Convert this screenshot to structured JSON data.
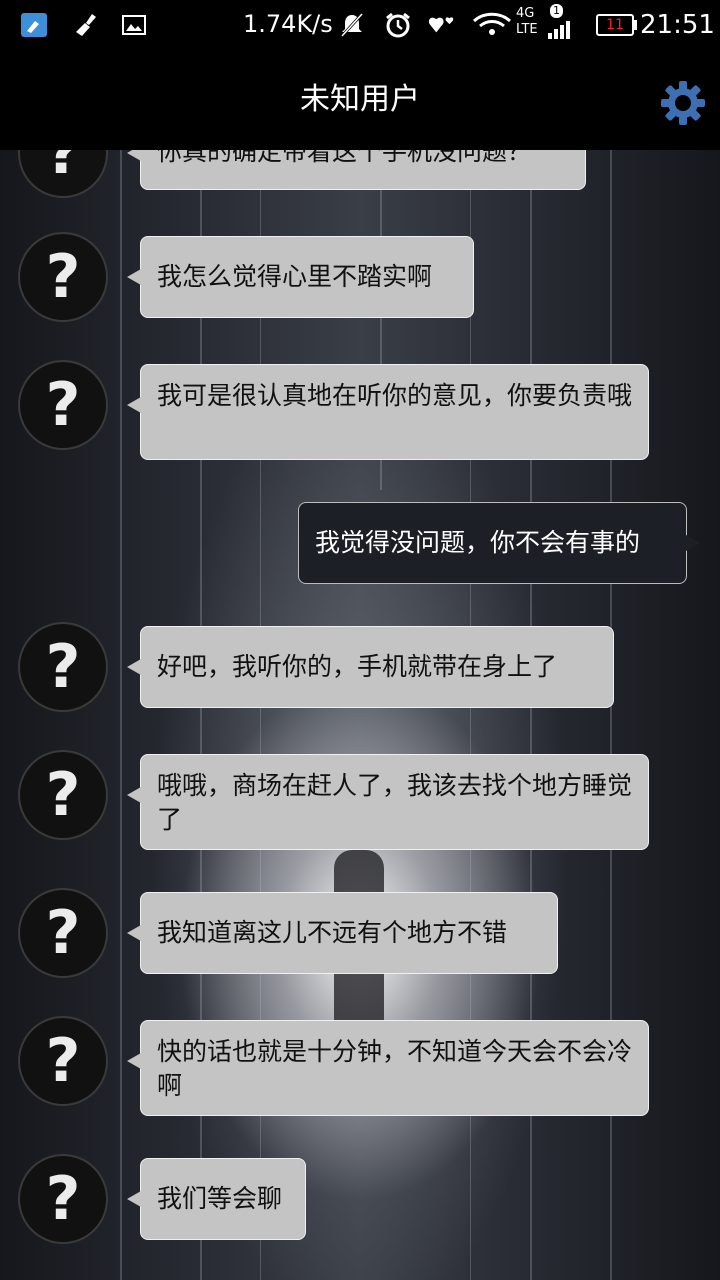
{
  "status_bar": {
    "net_speed": "1.74K/s",
    "network_type": "4G",
    "network_sub": "LTE",
    "sim_badge": "1",
    "battery_level": "11",
    "time": "21:51",
    "icons": [
      "cleaner-icon",
      "broom-icon",
      "image-icon",
      "mute-icon",
      "alarm-icon",
      "heart-icon",
      "wifi-icon",
      "signal-icon",
      "battery-icon"
    ]
  },
  "header": {
    "title": "未知用户",
    "settings_icon": "gear-icon"
  },
  "chat": {
    "avatar_symbol": "?",
    "messages": [
      {
        "sender": "other",
        "text": "你真的确定带着这个手机没问题？"
      },
      {
        "sender": "other",
        "text": "我怎么觉得心里不踏实啊"
      },
      {
        "sender": "other",
        "text": "我可是很认真地在听你的意见，你要负责哦"
      },
      {
        "sender": "me",
        "text": "我觉得没问题，你不会有事的"
      },
      {
        "sender": "other",
        "text": "好吧，我听你的，手机就带在身上了"
      },
      {
        "sender": "other",
        "text": "哦哦，商场在赶人了，我该去找个地方睡觉了"
      },
      {
        "sender": "other",
        "text": "我知道离这儿不远有个地方不错"
      },
      {
        "sender": "other",
        "text": "快的话也就是十分钟，不知道今天会不会冷啊"
      },
      {
        "sender": "other",
        "text": "我们等会聊"
      }
    ]
  },
  "colors": {
    "incoming_bubble": "#c4c4c4",
    "outgoing_bubble": "#1d1f26",
    "header_bg": "#000000",
    "settings_icon": "#3f6fb3",
    "battery_text": "#ff2020"
  }
}
